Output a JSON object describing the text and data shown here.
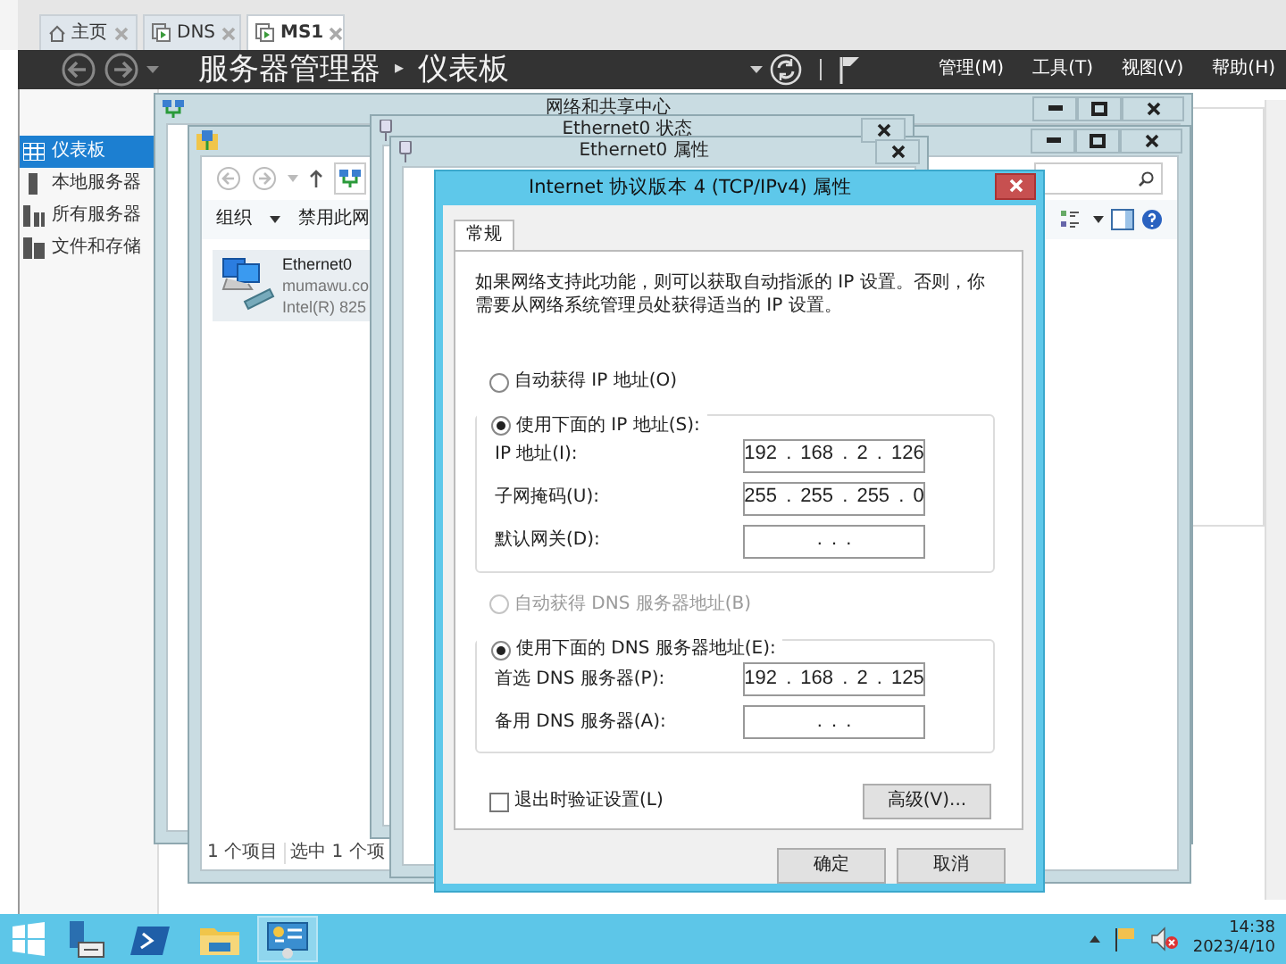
{
  "browser_tabs": [
    {
      "label": "主页",
      "kind": "home",
      "selected": false
    },
    {
      "label": "DNS",
      "kind": "server",
      "selected": false
    },
    {
      "label": "MS1",
      "kind": "server",
      "selected": true
    }
  ],
  "server_manager": {
    "title": "服务器管理器",
    "separator": "▸",
    "page": "仪表板",
    "menus": [
      "管理(M)",
      "工具(T)",
      "视图(V)",
      "帮助(H)"
    ]
  },
  "sidebar": {
    "items": [
      {
        "label": "仪表板",
        "kind": "dashboard",
        "selected": true
      },
      {
        "label": "本地服务器",
        "kind": "server",
        "selected": false
      },
      {
        "label": "所有服务器",
        "kind": "servers",
        "selected": false
      },
      {
        "label": "文件和存储",
        "kind": "storage",
        "selected": false
      }
    ]
  },
  "sharing_center_window": {
    "title": "网络和共享中心"
  },
  "connections_window": {
    "organize": "组织",
    "disable": "禁用此网",
    "adapter": {
      "name": "Ethernet0",
      "network": "mumawu.co",
      "device": "Intel(R) 825",
      "selected": true
    },
    "status": [
      "1 个项目",
      "选中 1 个项"
    ]
  },
  "status_window": {
    "title": "Ethernet0 状态"
  },
  "properties_window": {
    "title": "Ethernet0 属性"
  },
  "dialog": {
    "title": "Internet 协议版本 4 (TCP/IPv4) 属性",
    "tabs": [
      {
        "label": "常规",
        "selected": true
      }
    ],
    "intro": "如果网络支持此功能，则可以获取自动指派的 IP 设置。否则，你需要从网络系统管理员处获得适当的 IP 设置。",
    "ip_options": [
      {
        "label": "自动获得 IP 地址(O)",
        "selected": false,
        "disabled": false
      },
      {
        "label": "使用下面的 IP 地址(S):",
        "selected": true,
        "disabled": false
      }
    ],
    "ip_fields": [
      {
        "label": "IP 地址(I):",
        "value": "192 . 168 . 2 . 126"
      },
      {
        "label": "子网掩码(U):",
        "value": "255 . 255 . 255 . 0"
      },
      {
        "label": "默认网关(D):",
        "value": ". . ."
      }
    ],
    "dns_options": [
      {
        "label": "自动获得 DNS 服务器地址(B)",
        "selected": false,
        "disabled": true
      },
      {
        "label": "使用下面的 DNS 服务器地址(E):",
        "selected": true,
        "disabled": false
      }
    ],
    "dns_fields": [
      {
        "label": "首选 DNS 服务器(P):",
        "value": "192 . 168 . 2 . 125"
      },
      {
        "label": "备用 DNS 服务器(A):",
        "value": ". . ."
      }
    ],
    "validate": {
      "label": "退出时验证设置(L)",
      "checked": false
    },
    "advanced": "高级(V)...",
    "buttons": [
      "确定",
      "取消"
    ]
  },
  "taskbar": {
    "time": "14:38",
    "date": "2023/4/10"
  }
}
